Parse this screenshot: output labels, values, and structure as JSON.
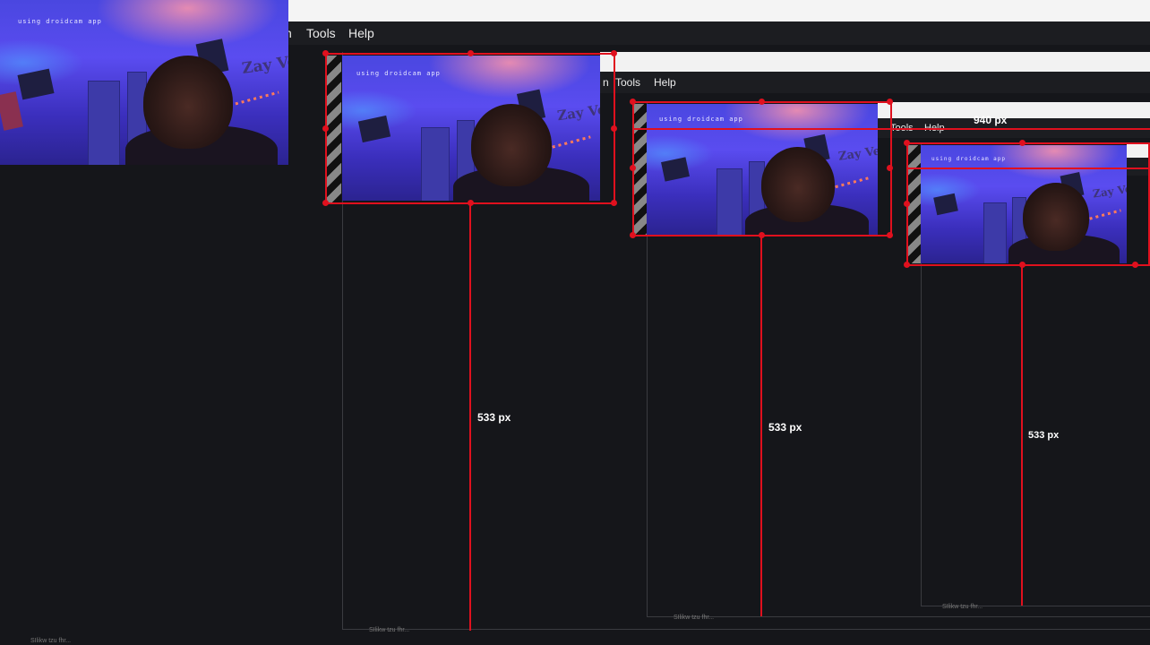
{
  "menu": {
    "partial_item": "n",
    "tools": "Tools",
    "help": "Help"
  },
  "webcam": {
    "overlay_text": "using droidcam app",
    "wall_text": "Zay Veo"
  },
  "measurements": {
    "height_label": "533 px",
    "width_label": "940 px"
  },
  "status": {
    "bottom_text": "SIlikw tzu fhr..."
  },
  "colors": {
    "background": "#15161a",
    "menubar": "#1c1d21",
    "measure_red": "#e0101e"
  }
}
